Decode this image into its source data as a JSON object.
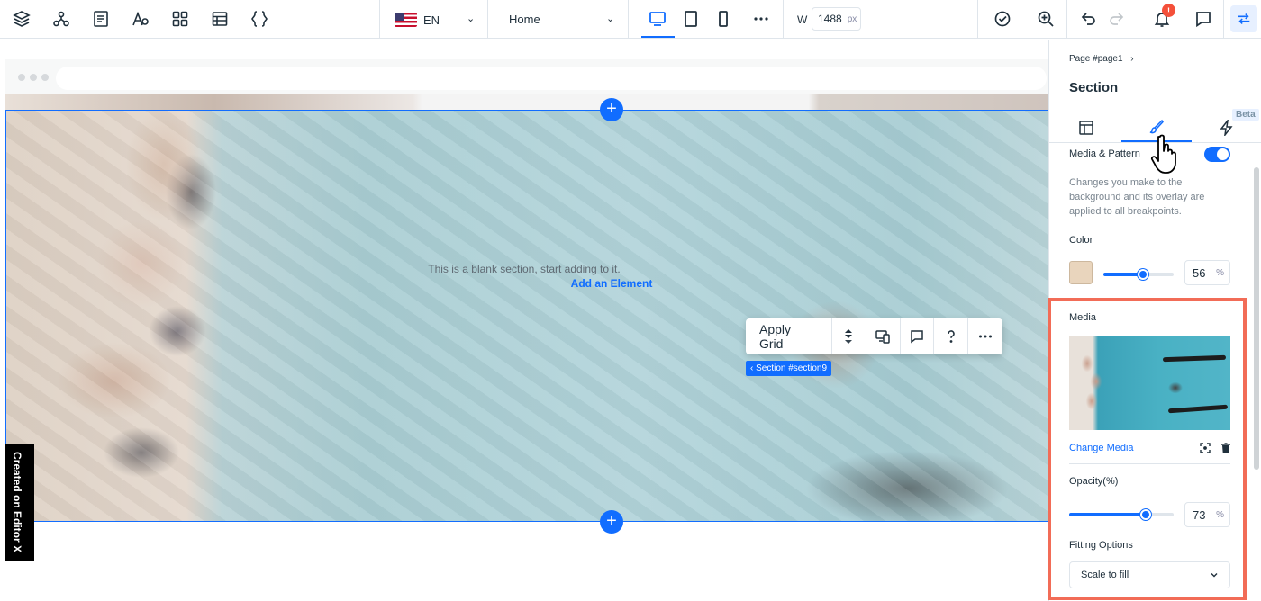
{
  "topbar": {
    "left_icons": [
      "layers-icon",
      "components-icon",
      "pages-icon",
      "fonts-icon",
      "apps-icon",
      "cms-icon",
      "code-icon"
    ],
    "language": {
      "code": "EN"
    },
    "page": {
      "selected": "Home"
    },
    "devices": [
      "desktop-icon",
      "tablet-icon",
      "mobile-icon",
      "more-icon"
    ],
    "width": {
      "label": "W",
      "value": "1488",
      "unit": "px"
    },
    "right_icons": [
      "publish-check-icon",
      "zoom-icon",
      "undo-icon",
      "redo-icon",
      "bell-icon",
      "comments-icon",
      "panel-toggle-icon"
    ],
    "notification_badge": "!"
  },
  "canvas": {
    "blank_text": "This is a blank section, start adding to it.",
    "add_element_link": "Add an Element",
    "section_tag": "‹ Section #section9",
    "created_badge": "Created on Editor X",
    "floating_toolbar": {
      "apply_grid": "Apply Grid",
      "icons": [
        "layers-stack-icon",
        "responsive-icon",
        "comment-icon",
        "help-icon",
        "more-icon"
      ]
    }
  },
  "panel": {
    "breadcrumb": "Page #page1",
    "title": "Section",
    "tabs": [
      "layout-tab",
      "design-tab",
      "interactions-tab"
    ],
    "beta": "Beta",
    "media_pattern": {
      "label": "Media & Pattern",
      "enabled": true
    },
    "description": "Changes you make to the background and its overlay are applied to all breakpoints.",
    "color": {
      "label": "Color",
      "swatch": "#e9d5bd",
      "opacity_value": "56",
      "unit": "%",
      "slider_fraction": 0.56
    },
    "media": {
      "label": "Media",
      "change_link": "Change Media"
    },
    "opacity": {
      "label": "Opacity(%)",
      "value": "73",
      "unit": "%",
      "slider_fraction": 0.73
    },
    "fitting": {
      "label": "Fitting Options",
      "selected": "Scale to fill"
    }
  },
  "colors": {
    "accent": "#116dff",
    "highlight": "#f26c57"
  }
}
